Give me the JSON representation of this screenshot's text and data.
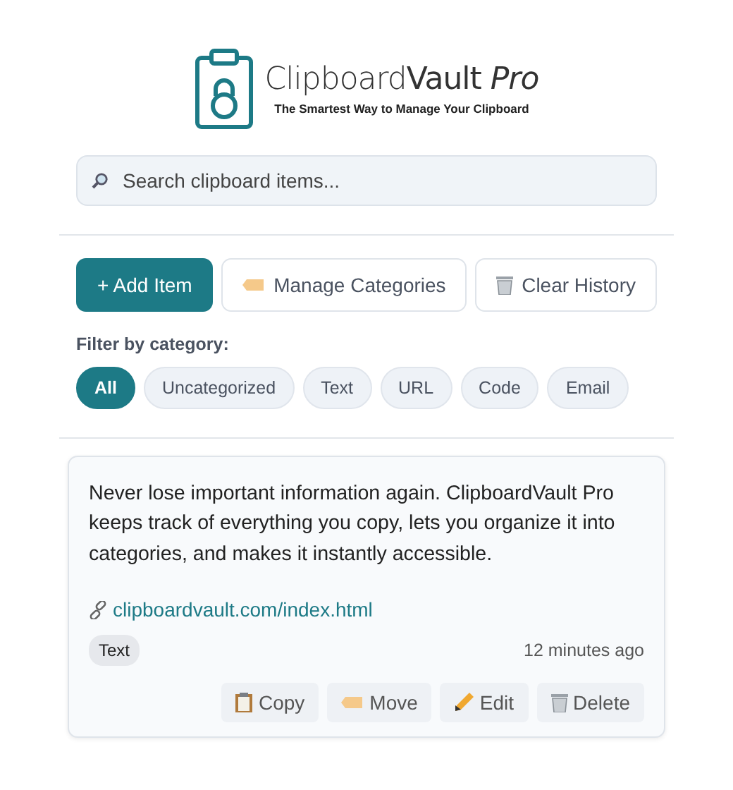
{
  "logo": {
    "title": "Clipboard**Vault** *Pro*",
    "tagline": "The Smartest Way to Manage Your Clipboard"
  },
  "search": {
    "placeholder": "Search clipboard items..."
  },
  "actions": [
    {
      "label": "+ Add Item",
      "kind": "primary"
    },
    {
      "label": "Manage Categories",
      "kind": "tag"
    },
    {
      "label": "Clear History",
      "kind": "trash"
    }
  ],
  "filter": {
    "label": "Filter by category:",
    "chips": [
      {
        "label": "All",
        "selected": true
      },
      {
        "label": "Uncategorized",
        "selected": false
      },
      {
        "label": "Text",
        "selected": false
      },
      {
        "label": "URL",
        "selected": false
      },
      {
        "label": "Code",
        "selected": false
      },
      {
        "label": "Email",
        "selected": false
      }
    ]
  },
  "items": [
    {
      "text": "Never lose important information again. ClipboardVault Pro keeps track of everything you copy, lets you organize it into categories, and makes it instantly accessible.",
      "link": "clipboardvault.com/index.html",
      "category": "Text",
      "time": "12 minutes ago",
      "buttons": [
        {
          "label": "Copy",
          "kind": "clipboard"
        },
        {
          "label": "Move",
          "kind": "tag"
        },
        {
          "label": "Edit",
          "kind": "pencil"
        },
        {
          "label": "Delete",
          "kind": "trash"
        }
      ]
    }
  ]
}
